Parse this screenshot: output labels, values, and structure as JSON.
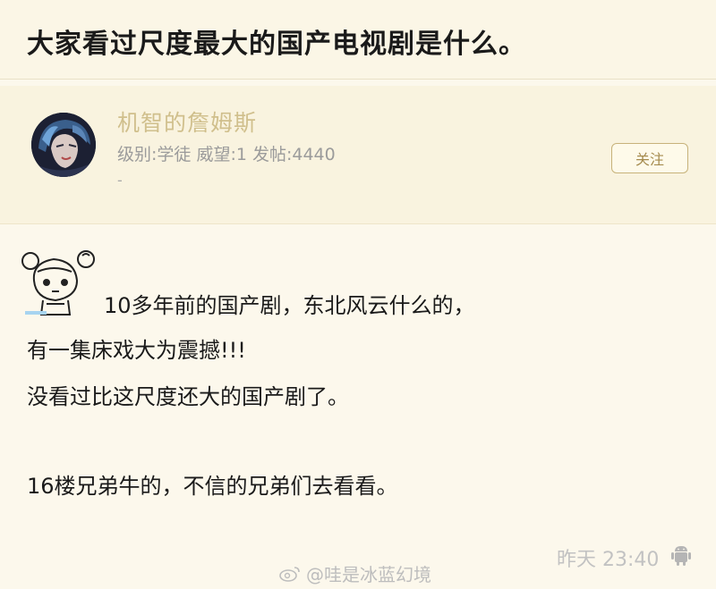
{
  "post": {
    "title": "大家看过尺度最大的国产电视剧是什么。"
  },
  "author": {
    "name": "机智的詹姆斯",
    "meta": "级别:学徒 威望:1 发帖:4440",
    "dash": "-",
    "follow_label": "关注"
  },
  "content": {
    "lines": [
      "10多年前的国产剧，东北风云什么的，",
      "有一集床戏大为震撼!!!",
      "没看过比这尺度还大的国产剧了。",
      "16楼兄弟牛的，不信的兄弟们去看看。"
    ],
    "timestamp": "昨天 23:40"
  },
  "watermark": {
    "text": "@哇是冰蓝幻境"
  },
  "icons": {
    "avatar": "anime-character-avatar",
    "emoji": "cartoon-girl-sticker",
    "device": "android-icon",
    "watermark": "weibo-icon"
  }
}
